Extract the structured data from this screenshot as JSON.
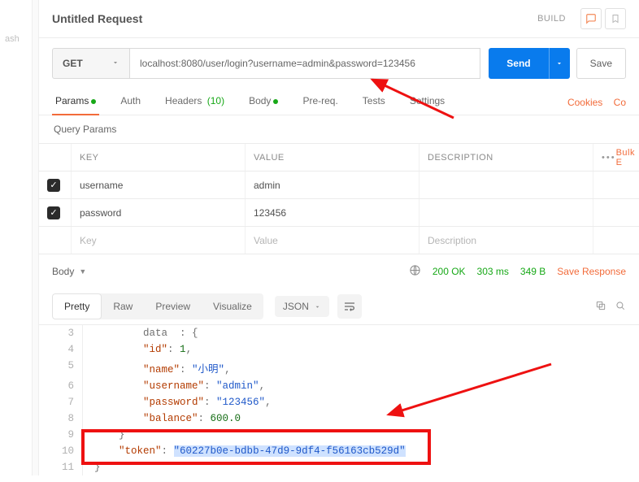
{
  "sidebar": {
    "label": "ash"
  },
  "title": "Untitled Request",
  "build_label": "BUILD",
  "request": {
    "method": "GET",
    "url": "localhost:8080/user/login?username=admin&password=123456",
    "send_label": "Send",
    "save_label": "Save"
  },
  "tabs": {
    "params": "Params",
    "auth": "Auth",
    "headers": "Headers",
    "headers_count": "(10)",
    "body": "Body",
    "prereq": "Pre-req.",
    "tests": "Tests",
    "settings": "Settings",
    "cookies": "Cookies",
    "code": "Co"
  },
  "query_params": {
    "title": "Query Params",
    "col_key": "KEY",
    "col_value": "VALUE",
    "col_desc": "DESCRIPTION",
    "bulk": "Bulk E",
    "ph_key": "Key",
    "ph_value": "Value",
    "ph_desc": "Description",
    "rows": [
      {
        "key": "username",
        "value": "admin"
      },
      {
        "key": "password",
        "value": "123456"
      }
    ]
  },
  "response": {
    "body_label": "Body",
    "status": "200 OK",
    "time": "303 ms",
    "size": "349 B",
    "save": "Save Response"
  },
  "viewer": {
    "pretty": "Pretty",
    "raw": "Raw",
    "preview": "Preview",
    "visualize": "Visualize",
    "format": "JSON"
  },
  "body_json": {
    "data": {
      "id": 1,
      "name": "小明",
      "username": "admin",
      "password": "123456",
      "balance": 600.0
    },
    "token": "60227b0e-bdbb-47d9-9df4-f56163cb529d"
  },
  "lines": {
    "l3": "    \"data\": {",
    "l4_k": "\"id\"",
    "l4_v": "1",
    "l5_k": "\"name\"",
    "l5_v": "\"小明\"",
    "l6_k": "\"username\"",
    "l6_v": "\"admin\"",
    "l7_k": "\"password\"",
    "l7_v": "\"123456\"",
    "l8_k": "\"balance\"",
    "l8_v": "600.0",
    "l9": "    }",
    "l10_k": "\"token\"",
    "l10_v": "\"60227b0e-bdbb-47d9-9df4-f56163cb529d\"",
    "l11": "}"
  }
}
